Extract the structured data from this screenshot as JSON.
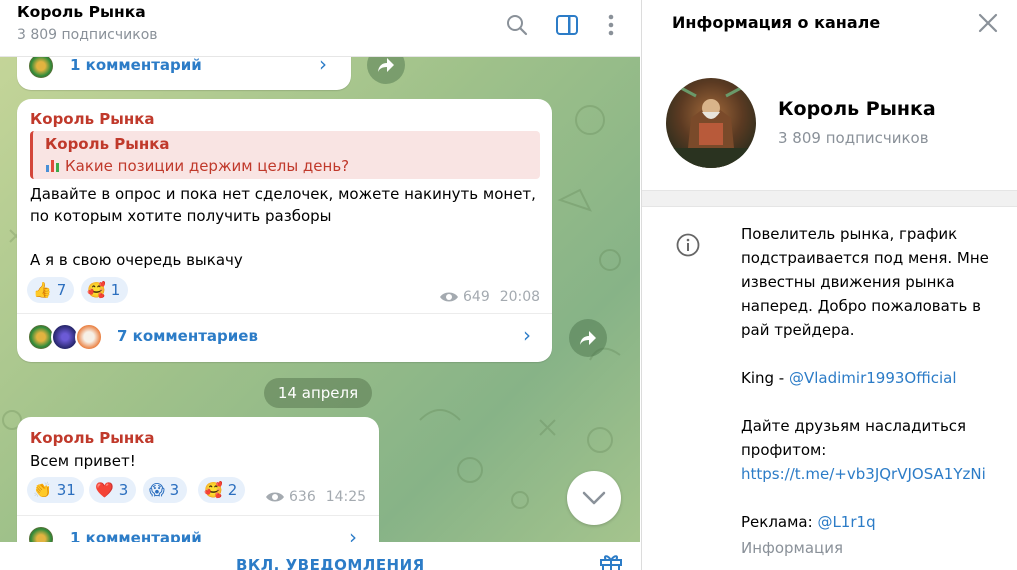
{
  "chat": {
    "title": "Король Рынка",
    "subscribers": "3 809 подписчиков",
    "top_comments": "1 комментарий",
    "message1": {
      "author": "Король Рынка",
      "quote_author": "Король Рынка",
      "quote_text": "Какие позиции держим целы день?",
      "text": "Давайте в опрос и пока нет сделочек, можете накинуть монет,\nпо которым хотите получить разборы\n\nА я в свою очередь выкачу",
      "reactions": [
        {
          "emoji": "👍",
          "count": "7"
        },
        {
          "emoji": "🥰",
          "count": "1"
        }
      ],
      "views": "649",
      "time": "20:08",
      "comments": "7 комментариев"
    },
    "date_separator": "14 апреля",
    "message2": {
      "author": "Король Рынка",
      "text": "Всем привет!",
      "reactions": [
        {
          "emoji": "👏",
          "count": "31"
        },
        {
          "emoji": "❤️",
          "count": "3"
        },
        {
          "emoji": "😱",
          "count": "3"
        },
        {
          "emoji": "🥰",
          "count": "2"
        }
      ],
      "views": "636",
      "time": "14:25",
      "comments": "1 комментарий"
    },
    "bottom_button": "ВКЛ. УВЕДОМЛЕНИЯ"
  },
  "info": {
    "header_title": "Информация о канале",
    "name": "Король Рынка",
    "subscribers": "3 809 подписчиков",
    "description": "Повелитель рынка, график подстраивается под меня. Мне известны движения рынка наперед. Добро пожаловать в рай трейдера.",
    "king_label": "King - ",
    "king_link": "@Vladimir1993Official",
    "share_text": "Дайте друзьям насладиться профитом:",
    "share_link": "https://t.me/+vb3JQrVJOSA1YzNi",
    "ads_label": "Реклама: ",
    "ads_link": "@L1r1q",
    "info_label": "Информация"
  },
  "colors": {
    "accent": "#2c7cc7",
    "author": "#c0392b",
    "reaction_bg": "#e7f0fb"
  },
  "icons": [
    "search-icon",
    "sidebar-toggle-icon",
    "more-vert-icon",
    "close-icon",
    "info-icon",
    "forward-icon",
    "chevron-right-icon",
    "chevron-down-icon",
    "gift-icon",
    "eye-icon"
  ]
}
